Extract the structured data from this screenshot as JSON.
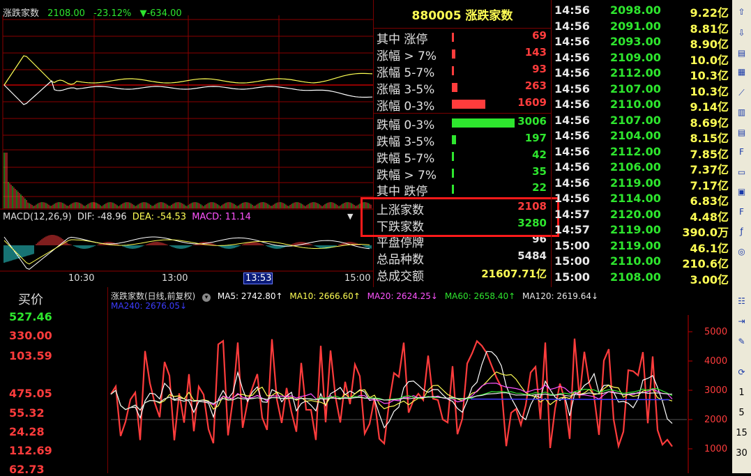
{
  "intraday": {
    "name": "涨跌家数",
    "price": "2108.00",
    "change_pct": "-23.12%",
    "change": "▼-634.00",
    "macd": {
      "label": "MACD(12,26,9)",
      "dif": "DIF: -48.96",
      "dea": "DEA: -54.53",
      "macd": "MACD: 11.14",
      "menu_glyph": "▼"
    },
    "time_axis": [
      "10:30",
      "13:00",
      "15:00"
    ],
    "cursor_time": "13:53"
  },
  "stats": {
    "title": "880005 涨跌家数",
    "rows": [
      {
        "label": "其中 涨停",
        "value": "69",
        "color": "#ff3c3c",
        "bar": 0.01
      },
      {
        "label": "涨幅 > 7%",
        "value": "143",
        "color": "#ff3c3c",
        "bar": 0.05
      },
      {
        "label": "涨幅 5-7%",
        "value": "93",
        "color": "#ff3c3c",
        "bar": 0.03
      },
      {
        "label": "涨幅 3-5%",
        "value": "263",
        "color": "#ff3c3c",
        "bar": 0.09
      },
      {
        "label": "涨幅 0-3%",
        "value": "1609",
        "color": "#ff3c3c",
        "bar": 0.53
      },
      {
        "label": "跌幅 0-3%",
        "value": "3006",
        "color": "#2ee62e",
        "bar": 1.0
      },
      {
        "label": "跌幅 3-5%",
        "value": "197",
        "color": "#2ee62e",
        "bar": 0.07
      },
      {
        "label": "跌幅 5-7%",
        "value": "42",
        "color": "#2ee62e",
        "bar": 0.015
      },
      {
        "label": "跌幅 > 7%",
        "value": "35",
        "color": "#2ee62e",
        "bar": 0.012
      },
      {
        "label": "其中 跌停",
        "value": "22",
        "color": "#2ee62e",
        "bar": 0.008
      },
      {
        "label": "上涨家数",
        "value": "2108",
        "color": "#ff3c3c",
        "bar": 0
      },
      {
        "label": "下跌家数",
        "value": "3280",
        "color": "#2ee62e",
        "bar": 0
      },
      {
        "label": "平盘停牌",
        "value": "96",
        "color": "#e8e8e8",
        "bar": 0
      },
      {
        "label": "总品种数",
        "value": "5484",
        "color": "#e8e8e8",
        "bar": 0
      },
      {
        "label": "总成交额",
        "value": "21607.71亿",
        "color": "#ffff54",
        "bar": 0
      }
    ]
  },
  "ticks": [
    {
      "time": "14:56",
      "price": "2098.00",
      "vol": "9.22亿"
    },
    {
      "time": "14:56",
      "price": "2091.00",
      "vol": "8.81亿"
    },
    {
      "time": "14:56",
      "price": "2093.00",
      "vol": "8.90亿"
    },
    {
      "time": "14:56",
      "price": "2109.00",
      "vol": "10.0亿"
    },
    {
      "time": "14:56",
      "price": "2112.00",
      "vol": "10.3亿"
    },
    {
      "time": "14:56",
      "price": "2107.00",
      "vol": "10.3亿"
    },
    {
      "time": "14:56",
      "price": "2110.00",
      "vol": "9.14亿"
    },
    {
      "time": "14:56",
      "price": "2107.00",
      "vol": "8.69亿"
    },
    {
      "time": "14:56",
      "price": "2104.00",
      "vol": "8.15亿"
    },
    {
      "time": "14:56",
      "price": "2112.00",
      "vol": "7.85亿"
    },
    {
      "time": "14:56",
      "price": "2106.00",
      "vol": "7.37亿"
    },
    {
      "time": "14:56",
      "price": "2119.00",
      "vol": "7.17亿"
    },
    {
      "time": "14:56",
      "price": "2114.00",
      "vol": "6.83亿"
    },
    {
      "time": "14:57",
      "price": "2120.00",
      "vol": "4.48亿"
    },
    {
      "time": "14:57",
      "price": "2119.00",
      "vol": "390.0万"
    },
    {
      "time": "15:00",
      "price": "2119.00",
      "vol": "46.1亿"
    },
    {
      "time": "15:00",
      "price": "2110.00",
      "vol": "210.6亿"
    },
    {
      "time": "15:00",
      "price": "2108.00",
      "vol": "3.00亿"
    }
  ],
  "bidlist": {
    "title": "买价",
    "values": [
      {
        "v": "527.46",
        "color": "#2ee62e"
      },
      {
        "v": "330.00",
        "color": "#ff3c3c"
      },
      {
        "v": "103.59",
        "color": "#ff3c3c"
      },
      {
        "v": "475.05",
        "color": "#ff3c3c"
      },
      {
        "v": "55.32",
        "color": "#ff3c3c"
      },
      {
        "v": "24.28",
        "color": "#ff3c3c"
      },
      {
        "v": "112.69",
        "color": "#ff3c3c"
      },
      {
        "v": "62.73",
        "color": "#ff3c3c"
      }
    ]
  },
  "daily": {
    "title": "涨跌家数(日线,前复权)",
    "ma5": "MA5: 2742.80↑",
    "ma10": "MA10: 2666.60↑",
    "ma20": "MA20: 2624.25↓",
    "ma60": "MA60: 2658.40↑",
    "ma120": "MA120: 2619.64↓",
    "ma240": "MA240: 2676.05↓",
    "y_ticks": [
      "5000",
      "4000",
      "3000",
      "2000",
      "1000"
    ],
    "colors": {
      "ma5": "#ffffff",
      "ma10": "#ffff54",
      "ma20": "#ff54ff",
      "ma60": "#2ee62e",
      "ma120": "#e8e8e8",
      "ma240": "#3c3cff"
    }
  },
  "toolbar": {
    "icons": [
      "up-arrow-icon",
      "down-arrow-icon",
      "list-icon",
      "grid-icon",
      "chart-icon",
      "candle-icon",
      "table-icon",
      "f10-icon",
      "doc-icon",
      "calendar-icon",
      "f12-icon",
      "fx-icon",
      "refresh-icon",
      "formula-icon",
      "exit-icon",
      "pencil-icon",
      "edit-icon"
    ],
    "numbers": [
      "1",
      "5",
      "15",
      "30"
    ]
  }
}
